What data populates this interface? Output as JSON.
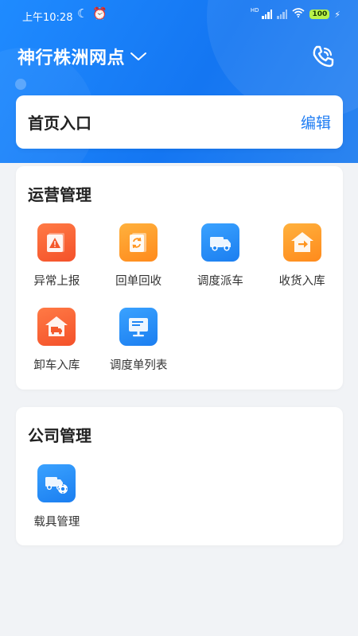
{
  "status_bar": {
    "time": "上午10:28",
    "network_label": "HD",
    "battery": "100"
  },
  "header": {
    "title": "神行株洲网点"
  },
  "home_entry": {
    "label": "首页入口",
    "edit_label": "编辑"
  },
  "operations": {
    "title": "运营管理",
    "items": [
      {
        "label": "异常上报",
        "icon": "warning-report-icon",
        "color": "#f4582b"
      },
      {
        "label": "回单回收",
        "icon": "receipt-recycle-icon",
        "color": "#ff951f"
      },
      {
        "label": "调度派车",
        "icon": "truck-dispatch-icon",
        "color": "#1f86f5"
      },
      {
        "label": "收货入库",
        "icon": "receive-warehouse-icon",
        "color": "#ff951f"
      },
      {
        "label": "卸车入库",
        "icon": "unload-warehouse-icon",
        "color": "#f4582b"
      },
      {
        "label": "调度单列表",
        "icon": "dispatch-list-icon",
        "color": "#1f86f5"
      }
    ]
  },
  "company": {
    "title": "公司管理",
    "items": [
      {
        "label": "载具管理",
        "icon": "vehicle-settings-icon",
        "color": "#1f86f5"
      }
    ]
  },
  "colors": {
    "header_blue": "#1476f2",
    "accent": "#1f7df3",
    "background": "#f1f3f6"
  }
}
